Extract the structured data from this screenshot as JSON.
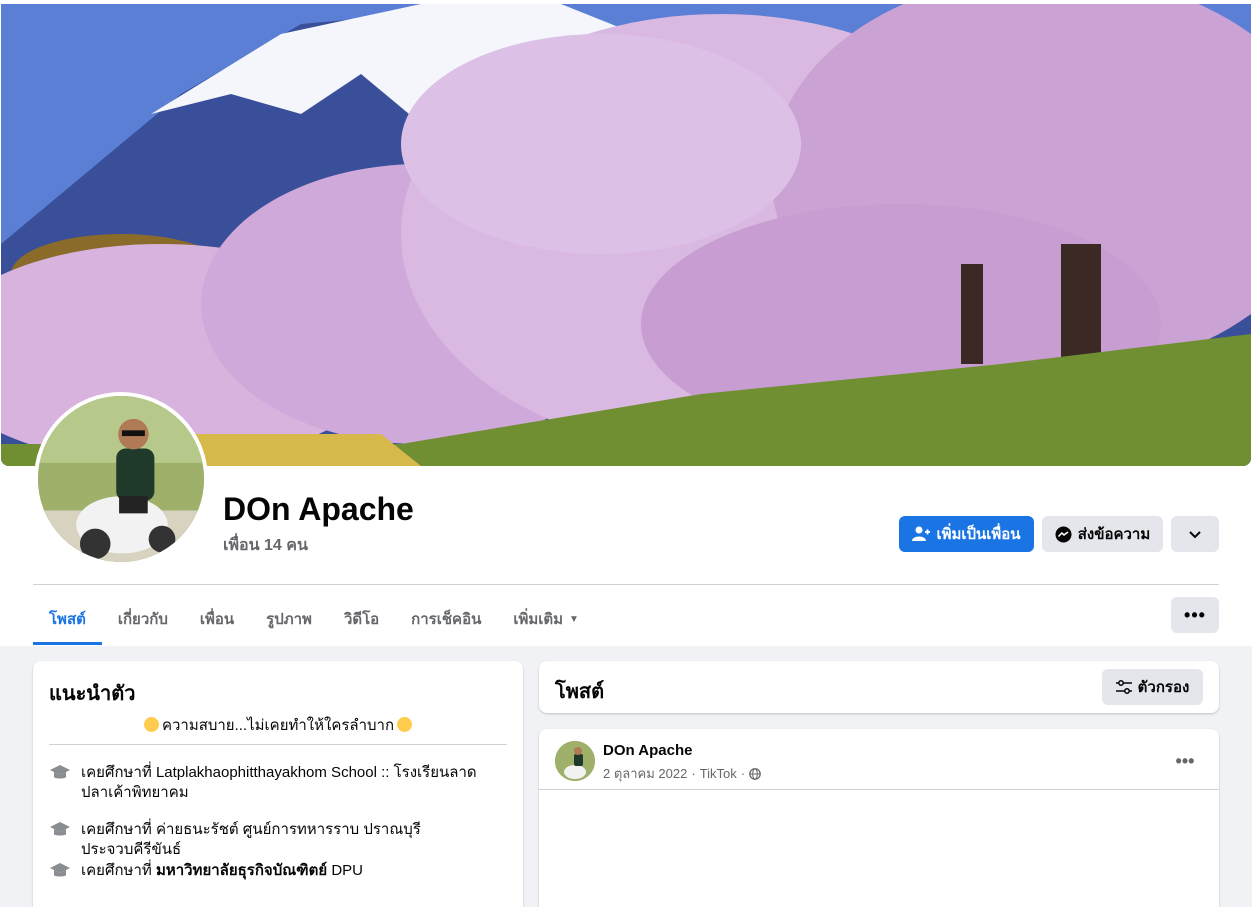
{
  "profile": {
    "name": "DOn Apache",
    "friend_count": "เพื่อน 14 คน"
  },
  "actions": {
    "add_friend": "เพิ่มเป็นเพื่อน",
    "message": "ส่งข้อความ"
  },
  "tabs": [
    {
      "label": "โพสต์",
      "active": true
    },
    {
      "label": "เกี่ยวกับ"
    },
    {
      "label": "เพื่อน"
    },
    {
      "label": "รูปภาพ"
    },
    {
      "label": "วิดีโอ"
    },
    {
      "label": "การเช็คอิน"
    },
    {
      "label": "เพิ่มเติม"
    }
  ],
  "intro": {
    "title": "แนะนำตัว",
    "bio": "ความสบาย...ไม่เคยทำให้ใครลำบาก",
    "education": [
      {
        "prefix": "เคยศึกษาที่",
        "school": "Latplakhaophitthayakhom School :: โรงเรียนลาดปลาเค้าพิทยาคม",
        "bold": false
      },
      {
        "prefix": "เคยศึกษาที่",
        "school": "ค่ายธนะรัชต์ ศูนย์การทหารราบ ปราณบุรี ประจวบคีรีขันธ์",
        "bold": false
      },
      {
        "prefix": "เคยศึกษาที่",
        "school": "มหาวิทยาลัยธุรกิจบัณฑิตย์",
        "suffix": "DPU",
        "bold": true
      }
    ]
  },
  "posts": {
    "title": "โพสต์",
    "filter_label": "ตัวกรอง",
    "items": [
      {
        "author": "DOn Apache",
        "date": "2 ตุลาคม 2022",
        "source": "TikTok",
        "separator": "·"
      }
    ]
  },
  "colors": {
    "accent": "#1b74e4",
    "secondary_button": "#e4e6eb",
    "muted_text": "#65676b"
  }
}
